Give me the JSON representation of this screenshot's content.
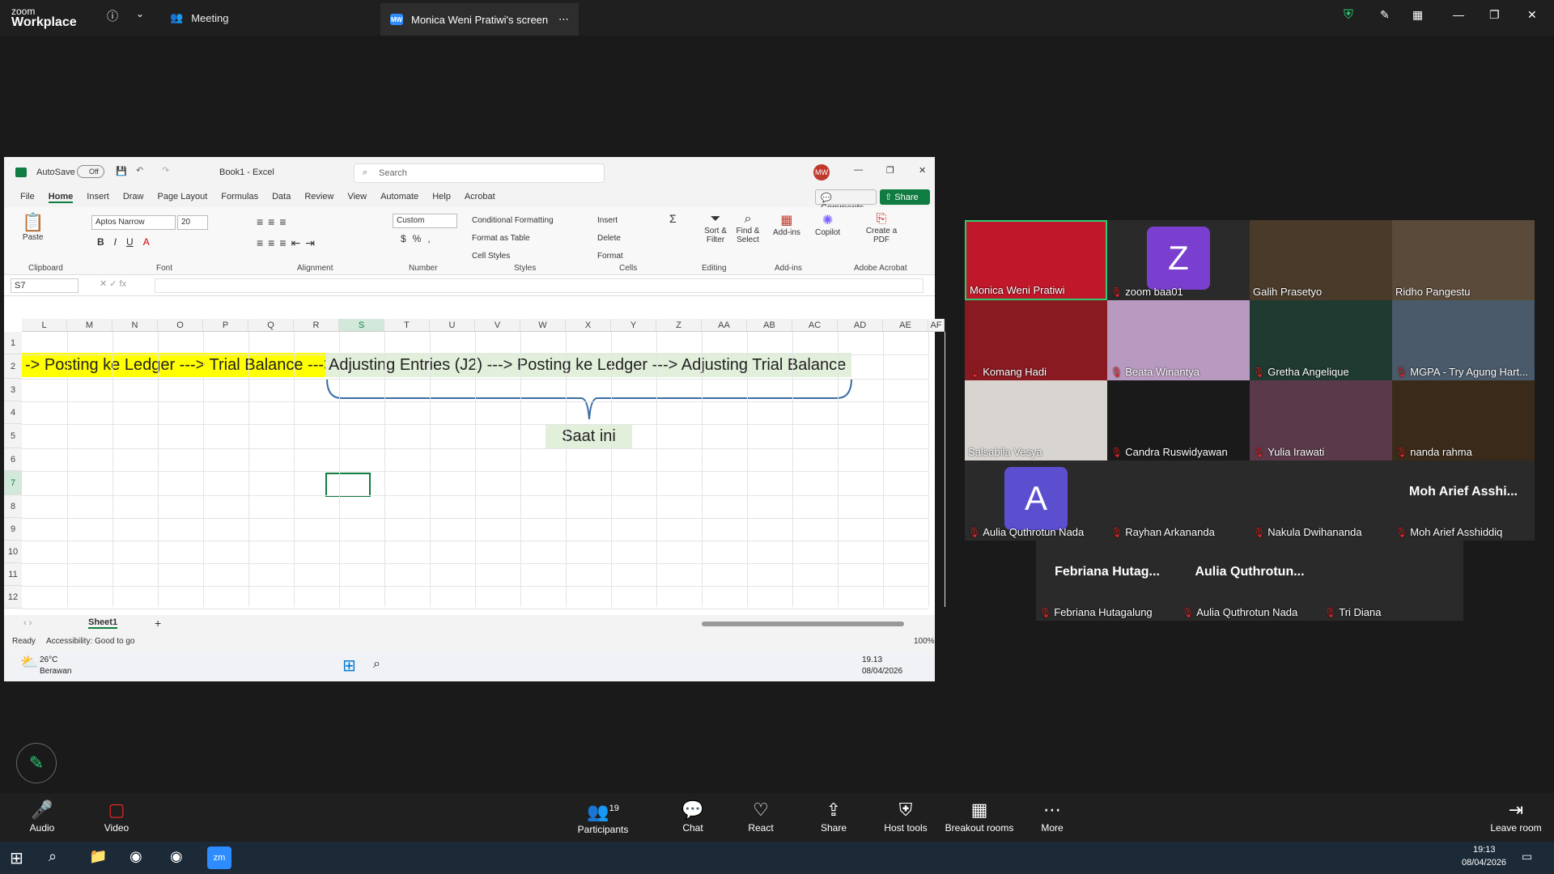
{
  "zoom": {
    "logo_line1": "zoom",
    "logo_line2": "Workplace",
    "tab_meeting": "Meeting",
    "tab_share": "Monica Weni Pratiwi's screen",
    "share_badge": "MW"
  },
  "excel": {
    "autosave": "AutoSave",
    "autosave_state": "Off",
    "filename": "Book1 - Excel",
    "search_placeholder": "Search",
    "user_initials": "MW",
    "comments": "Comments",
    "share": "Share",
    "menu": [
      "File",
      "Home",
      "Insert",
      "Draw",
      "Page Layout",
      "Formulas",
      "Data",
      "Review",
      "View",
      "Automate",
      "Help",
      "Acrobat"
    ],
    "ribbon": {
      "paste": "Paste",
      "clipboard": "Clipboard",
      "font_name": "Aptos Narrow",
      "font_size": "20",
      "font": "Font",
      "alignment": "Alignment",
      "number_format": "Custom",
      "number": "Number",
      "cond_fmt": "Conditional Formatting",
      "fmt_table": "Format as Table",
      "cell_styles": "Cell Styles",
      "styles": "Styles",
      "insert": "Insert",
      "delete": "Delete",
      "format": "Format",
      "cells": "Cells",
      "sort_filter": "Sort & Filter",
      "find_select": "Find & Select",
      "editing": "Editing",
      "addins": "Add-ins",
      "addins_group": "Add-ins",
      "copilot": "Copilot",
      "create_pdf": "Create a PDF",
      "adobe": "Adobe Acrobat"
    },
    "name_box": "S7",
    "columns": [
      "L",
      "M",
      "N",
      "O",
      "P",
      "Q",
      "R",
      "S",
      "T",
      "U",
      "V",
      "W",
      "X",
      "Y",
      "Z",
      "AA",
      "AB",
      "AC",
      "AD",
      "AE",
      "AF"
    ],
    "rows": [
      "1",
      "2",
      "3",
      "4",
      "5",
      "6",
      "7",
      "8",
      "9",
      "10",
      "11",
      "12"
    ],
    "cell_yellow": "-> Posting ke Ledger ---> Trial Balance --->",
    "cell_green": "Adjusting Entries (J2) ---> Posting ke Ledger ---> Adjusting Trial Balance",
    "cell_saat": "Saat ini",
    "sheet_tab": "Sheet1",
    "status_ready": "Ready",
    "status_access": "Accessibility: Good to go",
    "zoom_pct": "100%",
    "weather_temp": "26°C",
    "weather_desc": "Berawan",
    "tray_time": "19.13",
    "tray_date": "08/04/2026"
  },
  "participants": [
    {
      "name": "Monica Weni Pratiwi",
      "muted": false,
      "avatar": ""
    },
    {
      "name": "zoom baa01",
      "muted": true,
      "avatar": "Z"
    },
    {
      "name": "Galih Prasetyo",
      "muted": false,
      "avatar": ""
    },
    {
      "name": "Ridho Pangestu",
      "muted": false,
      "avatar": ""
    },
    {
      "name": "Komang Hadi",
      "muted": true,
      "avatar": ""
    },
    {
      "name": "Beata Winantya",
      "muted": true,
      "avatar": ""
    },
    {
      "name": "Gretha Angelique",
      "muted": true,
      "avatar": ""
    },
    {
      "name": "MGPA - Try Agung Hart...",
      "muted": true,
      "avatar": ""
    },
    {
      "name": "Salsabila Vesya",
      "muted": false,
      "avatar": ""
    },
    {
      "name": "Candra Ruswidyawan",
      "muted": true,
      "avatar": ""
    },
    {
      "name": "Yulia Irawati",
      "muted": true,
      "avatar": ""
    },
    {
      "name": "nanda rahma",
      "muted": true,
      "avatar": ""
    },
    {
      "name": "Aulia Quthrotun Nada",
      "muted": true,
      "avatar": "A"
    },
    {
      "name": "Rayhan Arkananda",
      "muted": true,
      "avatar": ""
    },
    {
      "name": "Nakula Dwihananda",
      "muted": true,
      "avatar": ""
    },
    {
      "name": "Moh Arief Asshiddiq",
      "muted": true,
      "avatar": "",
      "title": "Moh Arief Asshi..."
    },
    {
      "name": "Febriana Hutagalung",
      "muted": true,
      "avatar": "",
      "title": "Febriana Hutag..."
    },
    {
      "name": "Aulia Quthrotun Nada",
      "muted": true,
      "avatar": "",
      "title": "Aulia Quthrotun..."
    },
    {
      "name": "Tri Diana",
      "muted": true,
      "avatar": ""
    }
  ],
  "toolbar": {
    "audio": "Audio",
    "video": "Video",
    "participants": "Participants",
    "participants_count": "19",
    "chat": "Chat",
    "react": "React",
    "share": "Share",
    "host_tools": "Host tools",
    "breakout": "Breakout rooms",
    "more": "More",
    "leave": "Leave room"
  },
  "windows": {
    "time": "19:13",
    "date": "08/04/2026"
  },
  "colors": {
    "accent": "#2d8cff",
    "green_border": "#2ecc71",
    "excel_green": "#107c41",
    "yellow": "#ffff00",
    "light_green": "#e2efda"
  }
}
